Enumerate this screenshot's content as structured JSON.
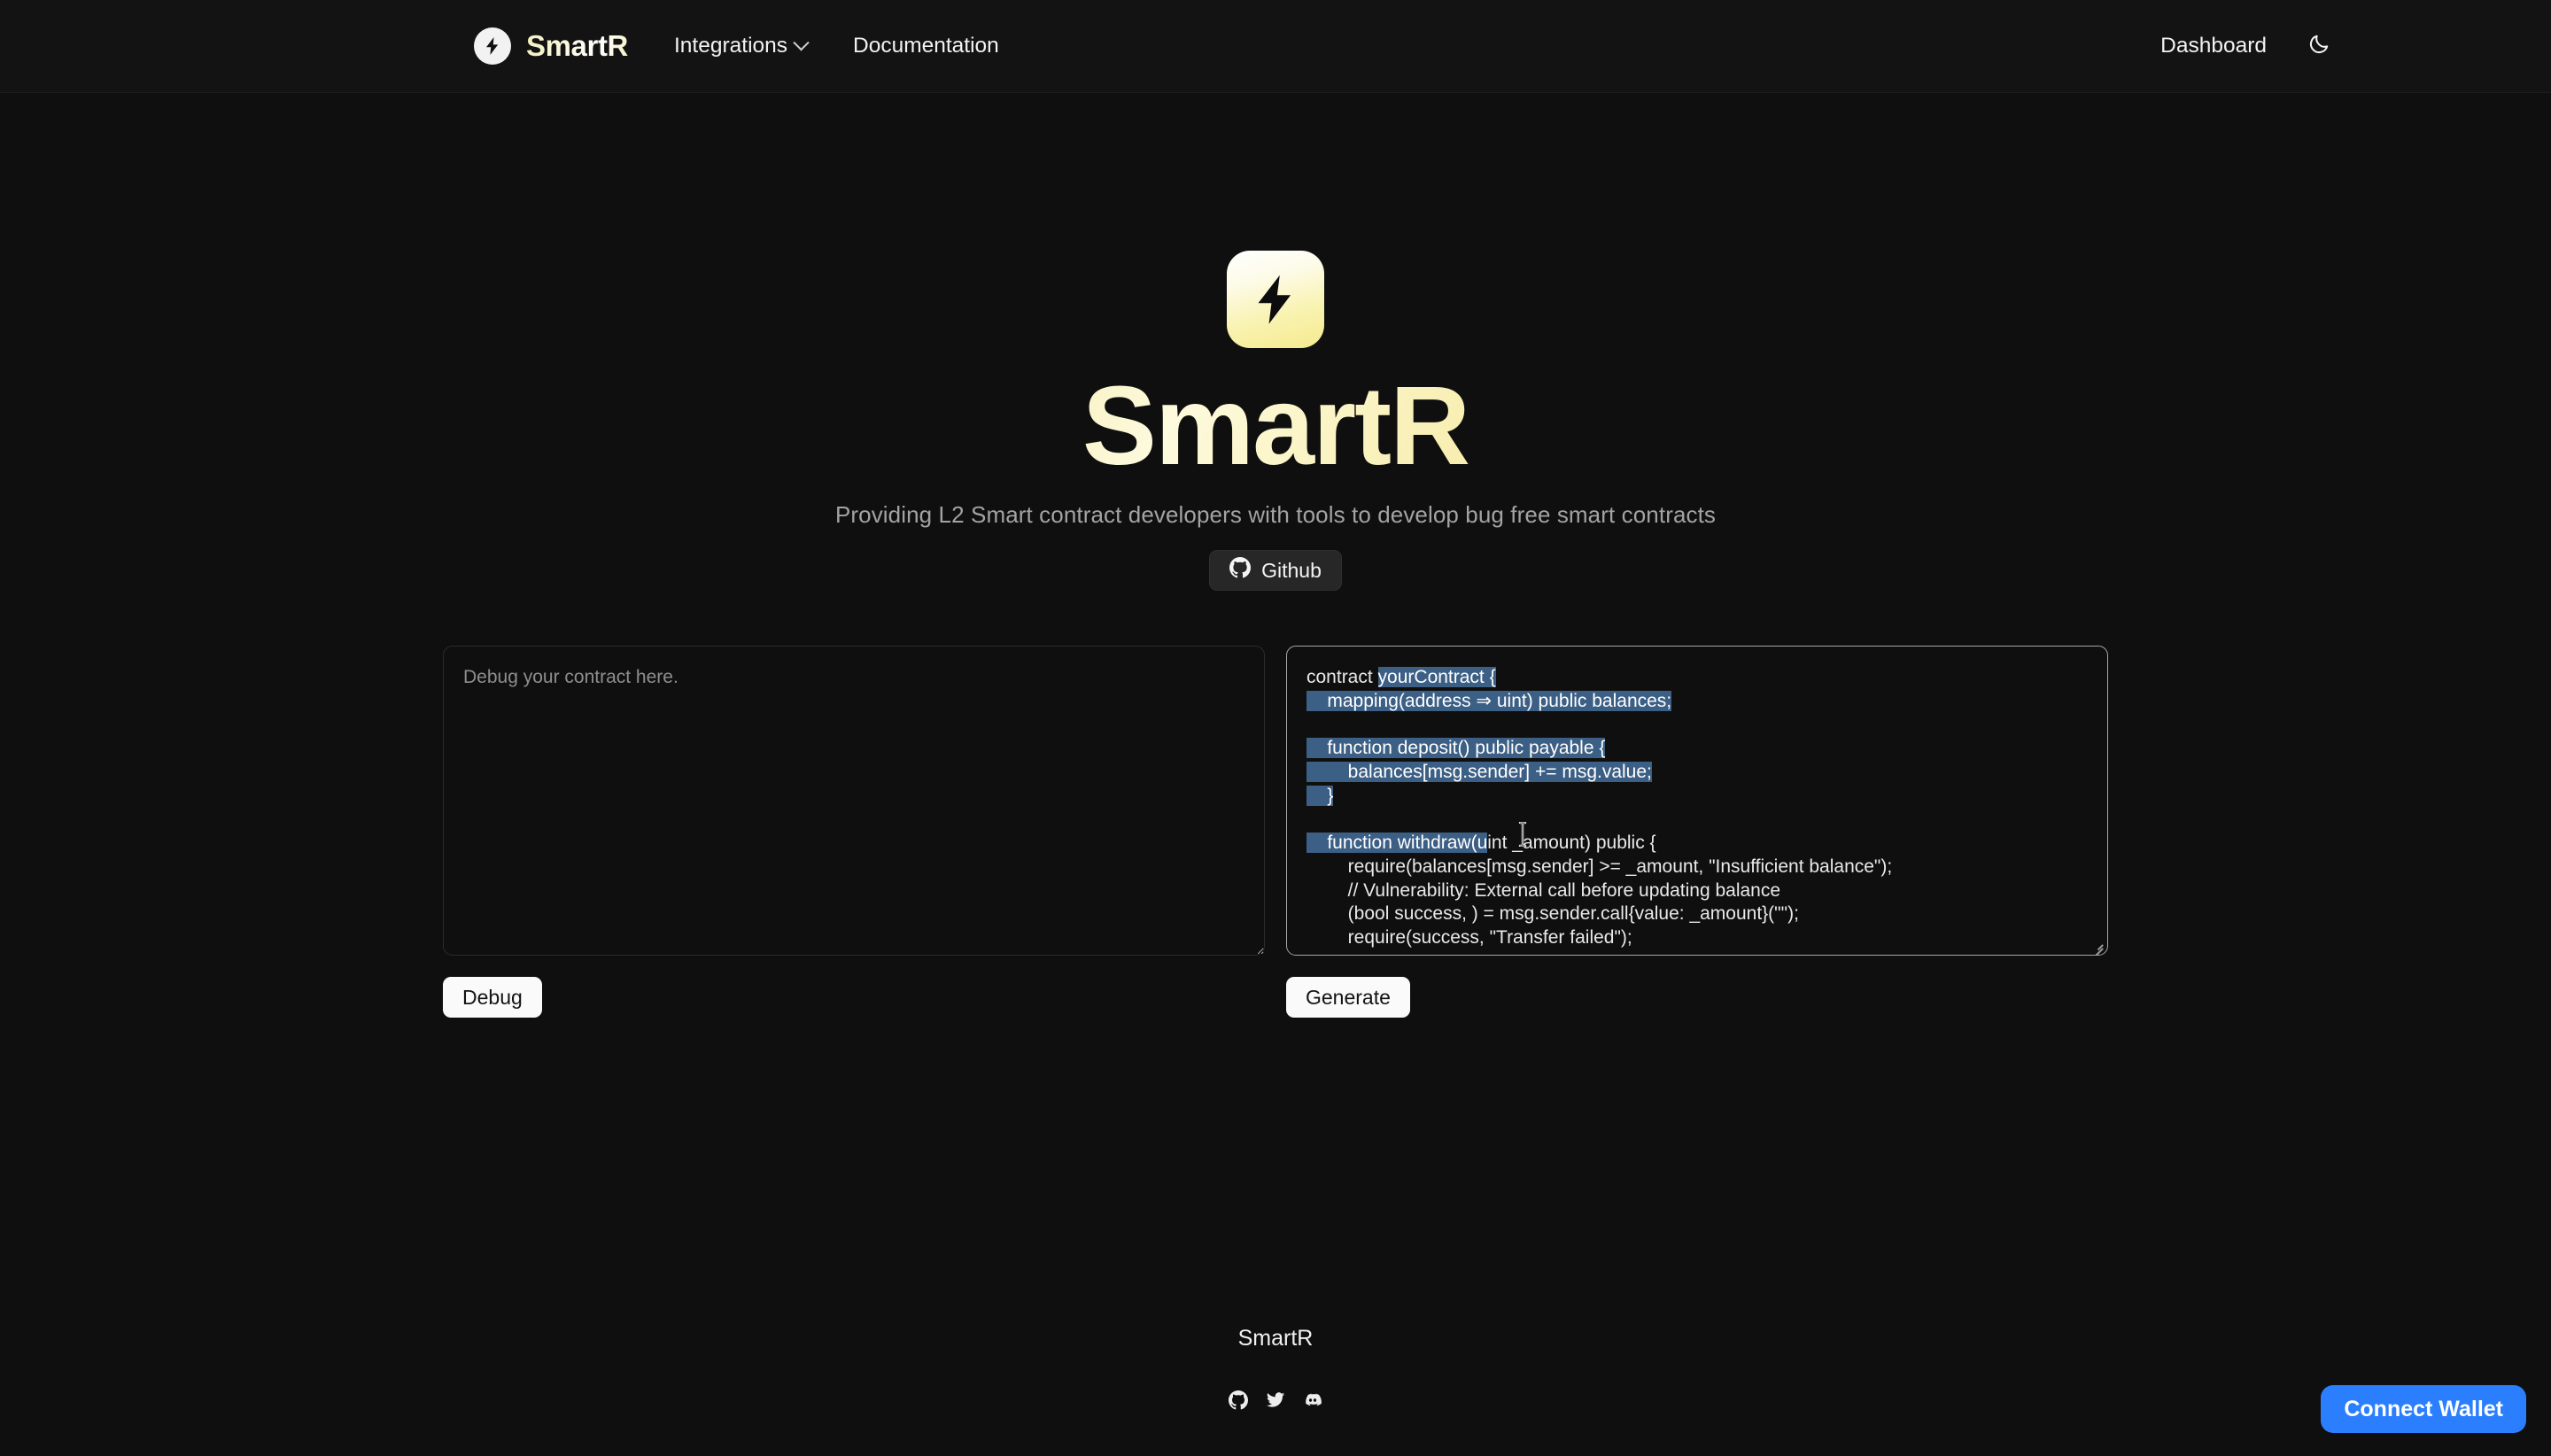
{
  "navbar": {
    "brand_name": "SmartR",
    "brand_icon": "lightning-bolt-icon",
    "links": [
      {
        "label": "Integrations",
        "has_chevron": true
      },
      {
        "label": "Documentation",
        "has_chevron": false
      }
    ],
    "dashboard_label": "Dashboard",
    "theme_icon": "moon-icon"
  },
  "hero": {
    "logo_icon": "lightning-bolt-icon",
    "title": "SmartR",
    "subtitle": "Providing L2 Smart contract developers with tools to develop bug free smart contracts",
    "github_button": {
      "label": "Github",
      "icon": "github-icon"
    }
  },
  "editors": {
    "debug": {
      "placeholder": "Debug your contract here.",
      "value": "",
      "button_label": "Debug"
    },
    "generate": {
      "button_label": "Generate",
      "code_lines": [
        {
          "text": "contract ",
          "selected": false
        },
        {
          "text": "yourContract {",
          "selected": true
        },
        {
          "text": "\n",
          "selected": true
        },
        {
          "text": "    mapping(address ⇒ uint) public balances;",
          "selected": true
        },
        {
          "text": "\n\n",
          "selected": true
        },
        {
          "text": "    function deposit() public payable {",
          "selected": true
        },
        {
          "text": "\n",
          "selected": true
        },
        {
          "text": "        balances[msg.sender] += msg.value;",
          "selected": true
        },
        {
          "text": "\n",
          "selected": true
        },
        {
          "text": "    }",
          "selected": true
        },
        {
          "text": "\n\n",
          "selected": true
        },
        {
          "text": "    function withdraw(u",
          "selected": true
        },
        {
          "text": "int _amount) public {",
          "selected": false
        },
        {
          "text": "\n        require(balances[msg.sender] >= _amount, \"Insufficient balance\");",
          "selected": false
        },
        {
          "text": "\n        // Vulnerability: External call before updating balance",
          "selected": false
        },
        {
          "text": "\n        (bool success, ) = msg.sender.call{value: _amount}(\"\");",
          "selected": false
        },
        {
          "text": "\n        require(success, \"Transfer failed\");",
          "selected": false
        }
      ],
      "full_code": "contract yourContract {\n    mapping(address ⇒ uint) public balances;\n\n    function deposit() public payable {\n        balances[msg.sender] += msg.value;\n    }\n\n    function withdraw(uint _amount) public {\n        require(balances[msg.sender] >= _amount, \"Insufficient balance\");\n        // Vulnerability: External call before updating balance\n        (bool success, ) = msg.sender.call{value: _amount}(\"\");\n        require(success, \"Transfer failed\");"
    }
  },
  "footer": {
    "name": "SmartR",
    "socials": [
      {
        "icon": "github-icon"
      },
      {
        "icon": "twitter-icon"
      },
      {
        "icon": "discord-icon"
      }
    ]
  },
  "wallet": {
    "label": "Connect Wallet"
  },
  "colors": {
    "page_background": "#0f0f0f",
    "navbar_background": "#131313",
    "brand_accent": "#f7f0be",
    "selection_highlight": "#3c5f85",
    "wallet_accent": "#2b7fff",
    "button_surface": "#fafafa"
  }
}
